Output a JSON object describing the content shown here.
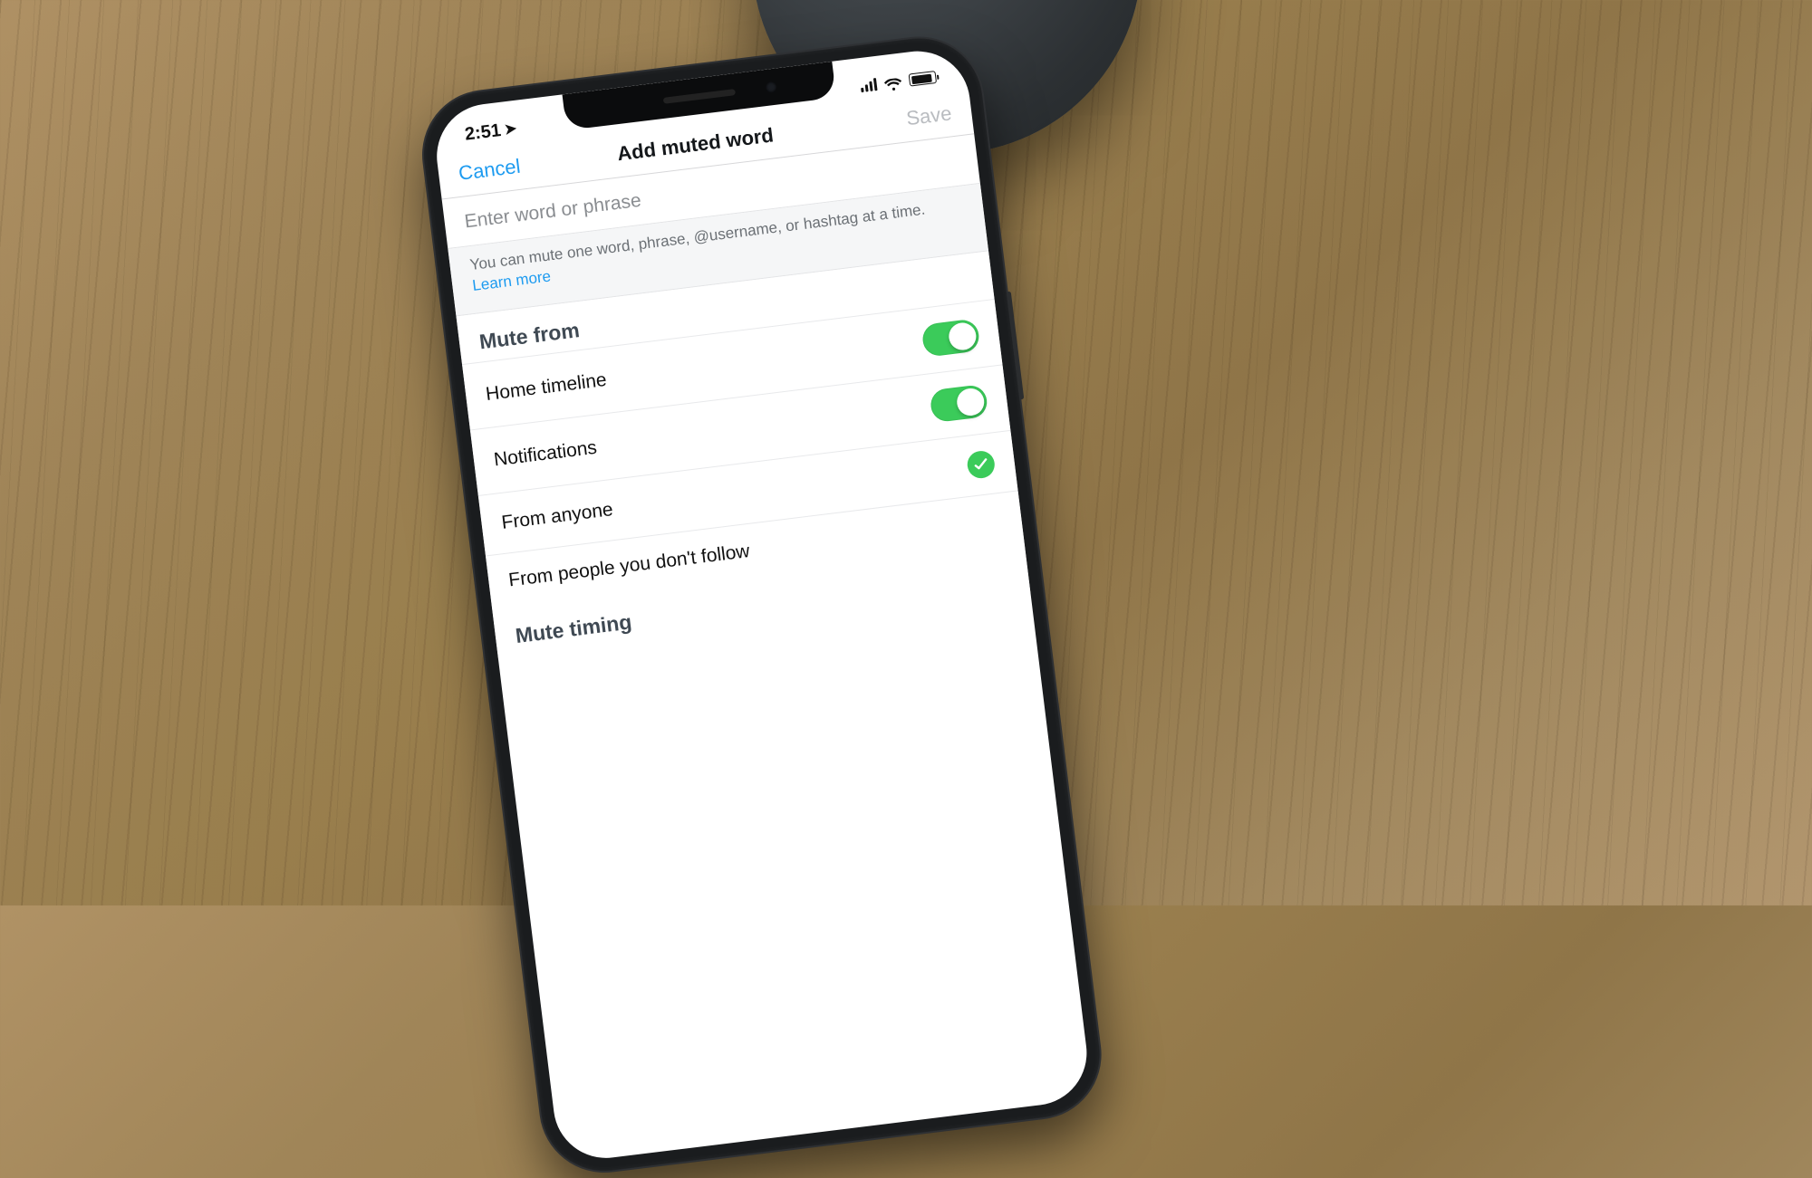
{
  "status": {
    "time": "2:51"
  },
  "nav": {
    "cancel": "Cancel",
    "title": "Add muted word",
    "save": "Save"
  },
  "input": {
    "placeholder": "Enter word or phrase"
  },
  "help": {
    "text": "You can mute one word, phrase, @username, or hashtag at a time. ",
    "link": "Learn more"
  },
  "sections": {
    "mute_from": {
      "header": "Mute from",
      "rows": {
        "home_timeline": "Home timeline",
        "notifications": "Notifications",
        "from_anyone": "From anyone",
        "from_non_follow": "From people you don't follow"
      }
    },
    "mute_timing": {
      "header": "Mute timing"
    }
  }
}
